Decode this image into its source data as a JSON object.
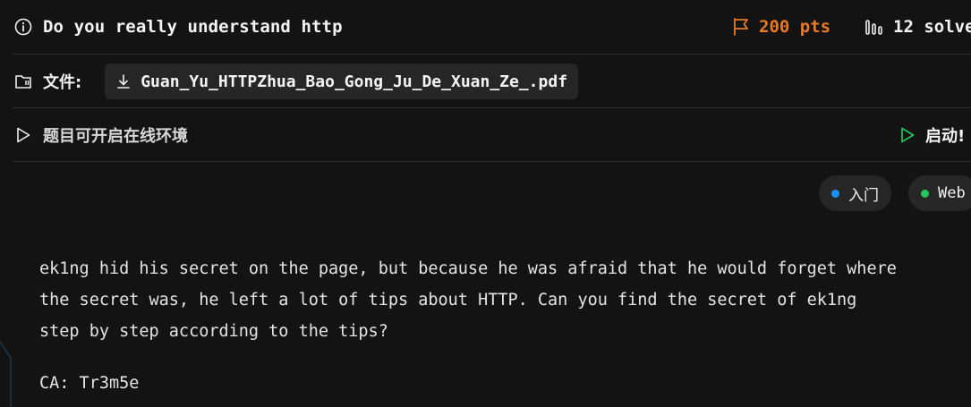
{
  "challenge": {
    "title": "Do you really understand http",
    "points_label": "200 pts",
    "solves_label": "12 solve"
  },
  "attachment": {
    "label": "文件:",
    "filename": "Guan_Yu_HTTPZhua_Bao_Gong_Ju_De_Xuan_Ze_.pdf"
  },
  "environment": {
    "label": "题目可开启在线环境",
    "start_label": "启动!"
  },
  "tags": [
    {
      "label": "入门",
      "dot_color": "#1e8fff"
    },
    {
      "label": "Web",
      "dot_color": "#22c55e"
    }
  ],
  "description": {
    "lines": [
      "ek1ng hid his secret on the page, but because he was afraid that he would forget where",
      "the secret was, he left a lot of tips about HTTP. Can you find the secret of ek1ng",
      "step by step according to the tips?"
    ],
    "author": "CA: Tr3m5e"
  },
  "colors": {
    "background": "#131313",
    "points": "#e97a23",
    "start_icon": "#22c55e",
    "chip_bg": "#262626"
  },
  "icons": {
    "title": "info-icon",
    "points": "flag-icon",
    "solves": "bar-chart-icon",
    "attachment": "folder-icon",
    "download": "download-icon",
    "environment": "play-icon",
    "start": "play-icon"
  }
}
